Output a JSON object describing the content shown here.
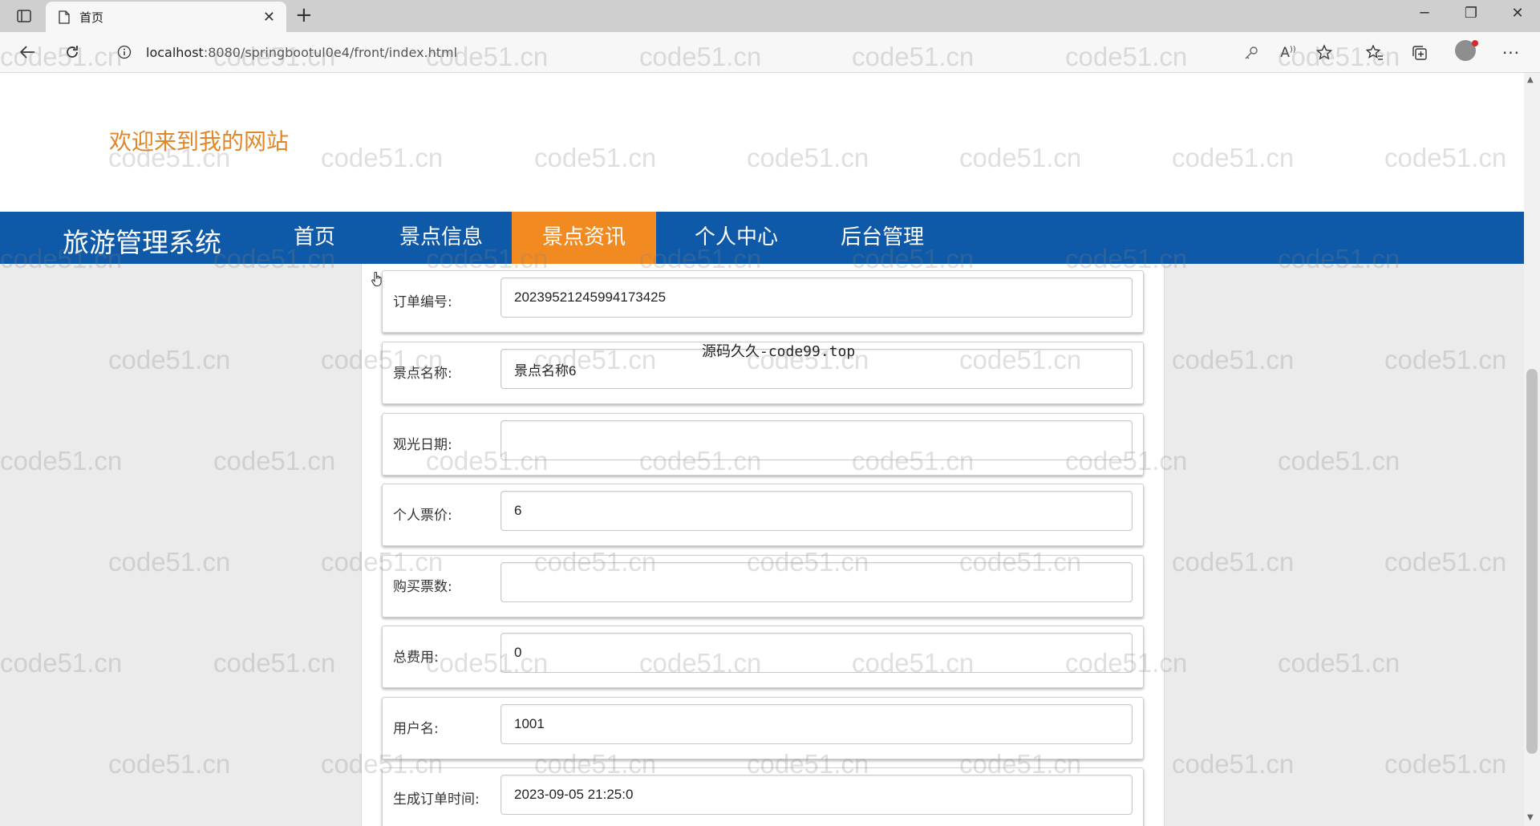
{
  "browser": {
    "tab_title": "首页",
    "url_host": "localhost",
    "url_path": ":8080/springbootul0e4/front/index.html",
    "icons": [
      "sidebar-toggle-icon",
      "page-icon",
      "close-icon",
      "new-tab-icon",
      "minimize-icon",
      "maximize-icon",
      "close-window-icon",
      "back-icon",
      "refresh-icon",
      "info-icon",
      "key-icon",
      "read-aloud-icon",
      "favorite-add-icon",
      "favorites-icon",
      "collections-icon",
      "profile-avatar",
      "more-icon"
    ]
  },
  "header": {
    "welcome": "欢迎来到我的网站"
  },
  "navbar": {
    "brand": "旅游管理系统",
    "items": [
      {
        "label": "首页",
        "active": false
      },
      {
        "label": "景点信息",
        "active": false
      },
      {
        "label": "景点资讯",
        "active": true
      },
      {
        "label": "个人中心",
        "active": false
      },
      {
        "label": "后台管理",
        "active": false
      }
    ],
    "active_color": "#f28a22",
    "bar_color": "#0e59a8"
  },
  "form": {
    "fields": [
      {
        "label": "订单编号:",
        "value": "20239521245994173425"
      },
      {
        "label": "景点名称:",
        "value": "景点名称6"
      },
      {
        "label": "观光日期:",
        "value": ""
      },
      {
        "label": "个人票价:",
        "value": "6"
      },
      {
        "label": "购买票数:",
        "value": ""
      },
      {
        "label": "总费用:",
        "value": "0"
      },
      {
        "label": "用户名:",
        "value": "1001"
      },
      {
        "label": "生成订单时间:",
        "value": "2023-09-05 21:25:0"
      }
    ]
  },
  "overlay_note": "源码久久-code99.top",
  "watermark_text": "code51.cn"
}
